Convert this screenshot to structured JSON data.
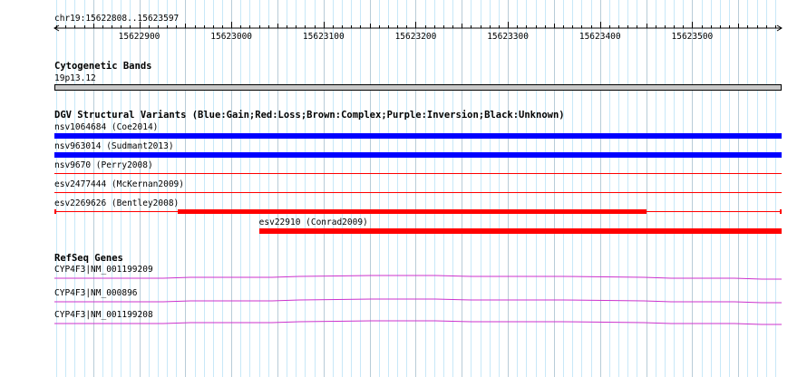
{
  "browser": {
    "location_label": "chr19:15622808..15623597",
    "ruler": {
      "start": 15622808,
      "end": 15623597,
      "tick_labels": [
        "15622900",
        "15623000",
        "15623100",
        "15623200",
        "15623300",
        "15623400",
        "15623500"
      ],
      "tick_values": [
        15622900,
        15623000,
        15623100,
        15623200,
        15623300,
        15623400,
        15623500
      ]
    }
  },
  "colors": {
    "grid_major": "#b8ccd8",
    "grid_minor": "#c8e8f8",
    "gain": "#0000ff",
    "loss": "#ff0000",
    "gene": "#cc33cc",
    "band_fill": "#c8c8c8"
  },
  "tracks": {
    "cytoband": {
      "title": "Cytogenetic Bands",
      "band_label": "19p13.12"
    },
    "dgv": {
      "title": "DGV Structural Variants (Blue:Gain;Red:Loss;Brown:Complex;Purple:Inversion;Black:Unknown)",
      "features": [
        {
          "label": "nsv1064684 (Coe2014)",
          "type": "gain",
          "start": 15622808,
          "end": 15623597,
          "style": "thick"
        },
        {
          "label": "nsv963014 (Sudmant2013)",
          "type": "gain",
          "start": 15622808,
          "end": 15623597,
          "style": "thick"
        },
        {
          "label": "nsv9670 (Perry2008)",
          "type": "loss",
          "start": 15622808,
          "end": 15623597,
          "style": "thin"
        },
        {
          "label": "esv2477444 (McKernan2009)",
          "type": "loss",
          "start": 15622808,
          "end": 15623597,
          "style": "thin"
        },
        {
          "label": "esv2269626 (Bentley2008)",
          "type": "loss",
          "start": 15622808,
          "end": 15623597,
          "thick_start": 15622942,
          "thick_end": 15623450,
          "style": "segmented"
        },
        {
          "label": "esv22910 (Conrad2009)",
          "type": "loss",
          "start": 15623030,
          "end": 15623597,
          "style": "thick"
        }
      ]
    },
    "refseq": {
      "title": "RefSeq Genes",
      "genes": [
        {
          "label": "CYP4F3|NM_001199209"
        },
        {
          "label": "CYP4F3|NM_000896"
        },
        {
          "label": "CYP4F3|NM_001199208"
        }
      ]
    }
  }
}
